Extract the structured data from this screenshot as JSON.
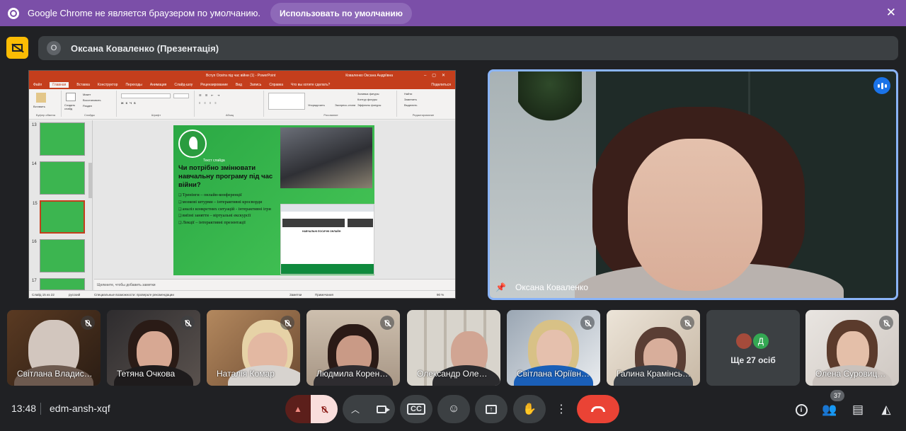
{
  "banner": {
    "message": "Google Chrome не является браузером по умолчанию.",
    "default_button": "Использовать по умолчанию"
  },
  "presentation_bar": {
    "avatar_letter": "О",
    "title": "Оксана Коваленко (Презентація)"
  },
  "powerpoint": {
    "file_name": "Вступ Освіта під час війни (1)  -  PowerPoint",
    "user_name": "Коваленко Оксана Андріївна",
    "tabs": [
      "Файл",
      "Главная",
      "Вставка",
      "Конструктор",
      "Переходы",
      "Анимация",
      "Слайд-шоу",
      "Рецензирование",
      "Вид",
      "Запись",
      "Справка",
      "Что вы хотите сделать?"
    ],
    "share_label": "Поделиться",
    "ribbon": {
      "clipboard": "Буфер обмена",
      "paste": "Вставить",
      "slides": "Слайды",
      "create_slide": "Создать слайд",
      "layout": "Макет",
      "reset": "Восстановить",
      "section": "Раздел",
      "font": "Шрифт",
      "paragraph": "Абзац",
      "drawing": "Рисование",
      "arrange": "Упорядочить",
      "quick_styles": "Экспресс-стили",
      "fill": "Заливка фигуры",
      "outline": "Контур фигуры",
      "effects": "Эффекты фигуры",
      "editing": "Редактирование",
      "find": "Найти",
      "replace": "Заменить",
      "select": "Выделить"
    },
    "thumbnails": [
      "13",
      "14",
      "15",
      "16",
      "17"
    ],
    "slide": {
      "subtitle": "Текст слайда",
      "heading": "Чи потрібно змінювати навчальну програму під час війни?",
      "bullets": [
        "Тренінги – онлайн-конференції",
        "мозкові штурми – інтерактивні кросворди",
        "аналіз конкретних ситуацій - інтерактивні ігри",
        "виїзні заняття – віртуальні екскурсії",
        "Лекції – інтерактивні презентації"
      ],
      "site_heading": "НАВЧАЛЬНІ ЛОСИЧНІ ОНЛАЙН"
    },
    "notes_placeholder": "Щелкните, чтобы добавить заметки",
    "status": {
      "slide": "Слайд 15 из 22",
      "language": "русский",
      "accessibility": "Специальные возможности: проверьте рекомендации",
      "notes": "Заметки",
      "comments": "Примечания",
      "zoom": "90 %"
    }
  },
  "main_video": {
    "name": "Оксана Коваленко"
  },
  "tiles": [
    {
      "name": "Світлана Владис…"
    },
    {
      "name": "Тетяна Очкова"
    },
    {
      "name": "Наталія Комар"
    },
    {
      "name": "Людмила Корен…"
    },
    {
      "name": "Олександр Оле…"
    },
    {
      "name": "Світлана Юріївн…"
    },
    {
      "name": "Галина Крамінсь…"
    },
    {
      "name": "Олена Суровиц…"
    }
  ],
  "more_tile": {
    "avatar_letter": "Д",
    "label": "Ще 27 осіб"
  },
  "bottom_bar": {
    "time": "13:48",
    "meeting_code": "edm-ansh-xqf",
    "participants_count": "37"
  },
  "colors": {
    "banner": "#7b4fa8",
    "accent": "#8ab4f8",
    "end_call": "#ea4335",
    "ppt": "#c43e1c"
  }
}
